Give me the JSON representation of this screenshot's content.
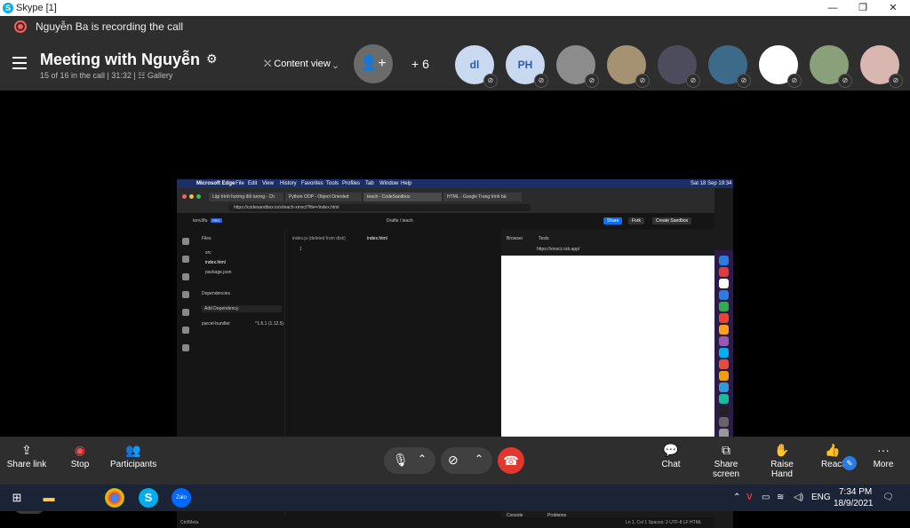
{
  "window": {
    "title": "Skype [1]",
    "minimize": "—",
    "restore": "❐",
    "close": "✕"
  },
  "recording": {
    "text": "Nguyễn Ba is recording the call"
  },
  "header": {
    "title": "Meeting with Nguyễn",
    "subtitle": "15 of 16 in the call | 31:32 | ☷ Gallery",
    "content_view": "Content view",
    "more_count": "+ 6",
    "avatars": [
      {
        "initials": "dl",
        "bg": "#c9d9f0",
        "fg": "#2b5ca8"
      },
      {
        "initials": "PH",
        "bg": "#c9d9f0",
        "fg": "#2b5ca8"
      },
      {
        "initials": "",
        "bg": "#8c8c8c",
        "fg": "#fff"
      },
      {
        "initials": "",
        "bg": "#a59272",
        "fg": "#fff"
      },
      {
        "initials": "",
        "bg": "#4c4c5c",
        "fg": "#fff"
      },
      {
        "initials": "",
        "bg": "#3e6a8a",
        "fg": "#fff"
      },
      {
        "initials": "",
        "bg": "#ffffff",
        "fg": "#fff"
      },
      {
        "initials": "",
        "bg": "#8aa07a",
        "fg": "#fff"
      },
      {
        "initials": "",
        "bg": "#d9b6b0",
        "fg": "#fff"
      }
    ]
  },
  "shared_screen": {
    "mac_menu": [
      "Microsoft Edge",
      "File",
      "Edit",
      "View",
      "History",
      "Favorites",
      "Tools",
      "Profiles",
      "Tab",
      "Window",
      "Help"
    ],
    "mac_clock": "Sat 18 Sep 19:34",
    "tabs": [
      "Lập trình hướng đối tượng - Ch",
      "Python OOP - Object Oriented",
      "teach - CodeSandbox",
      "HTML - Google Trang trình bà"
    ],
    "url": "https://codesandbox.io/s/teach-xmxct?file=/index.html",
    "workspace": "tonv3fu",
    "workspace_badge": "PRO",
    "crumb": "Drafts / teach",
    "share": "Share",
    "fork": "Fork",
    "create": "Create Sandbox",
    "files_title": "Files",
    "files": [
      "src",
      "index.html",
      "package.json"
    ],
    "dependencies_title": "Dependencies",
    "add_dependency": "Add Dependency",
    "dep_name": "parcel-bundler",
    "dep_version": "^1.6.1 (1.12.5)",
    "editor_tabs": [
      "index.js (deleted from disk)",
      "index.html"
    ],
    "line_number": "1",
    "browser_tab": "Browser",
    "tests_tab": "Tests",
    "preview_url": "https://xmxct.csb.app/",
    "console": "Console",
    "problems": "Problems",
    "status_left": "Ctrl/Meta",
    "status_right": "Ln 1, Col 1   Spaces: 2   UTF-8   LF   HTML"
  },
  "skype_logo": "S",
  "callbar": {
    "share_link": "Share link",
    "stop": "Stop",
    "participants": "Participants",
    "chat": "Chat",
    "share_screen": "Share screen",
    "raise_hand": "Raise Hand",
    "react": "React",
    "more": "More"
  },
  "taskbar": {
    "lang": "ENG",
    "time": "7:34 PM",
    "date": "18/9/2021",
    "zalo": "Zalo"
  }
}
